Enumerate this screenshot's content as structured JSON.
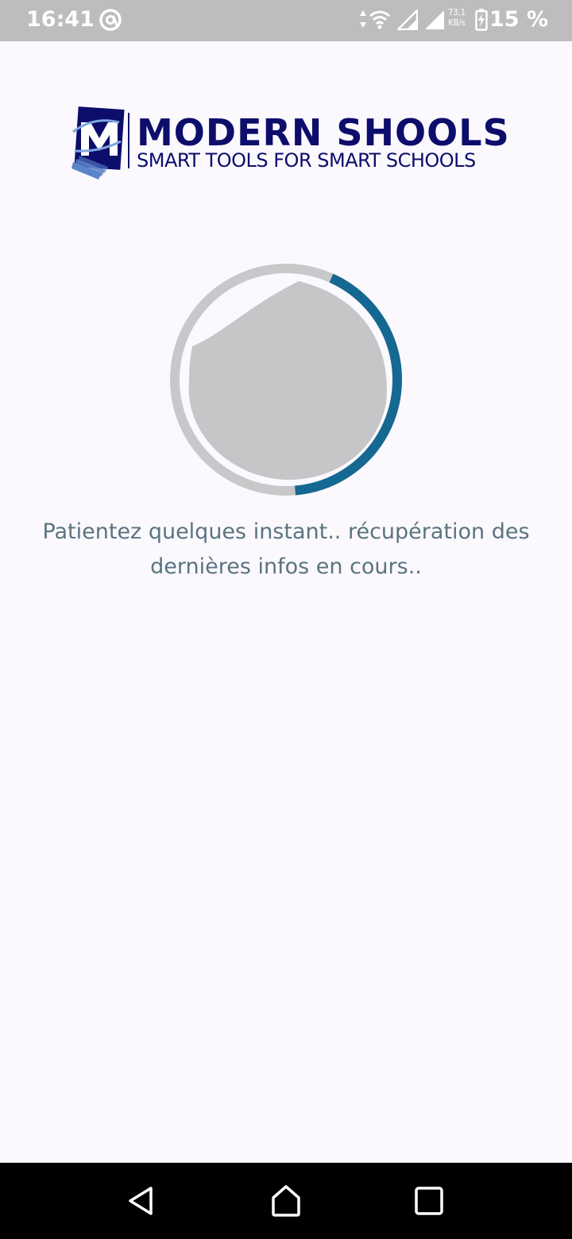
{
  "status_bar": {
    "time": "16:41",
    "net_speed_value": "73,1",
    "net_speed_unit": "KB/s",
    "battery_percent": "15 %",
    "icons": [
      "at-sign-icon",
      "data-arrows-icon",
      "wifi-icon",
      "signal-icon",
      "signal-icon",
      "battery-charging-icon"
    ]
  },
  "logo": {
    "title": "MODERN SHOOLS",
    "subtitle": "SMART TOOLS FOR SMART SCHOOLS",
    "brand_color": "#0d0d6b"
  },
  "loader": {
    "progress": 0.42,
    "track_color": "#c8c8ca",
    "progress_color": "#156891"
  },
  "message": {
    "text": "Patientez quelques instant.. récupération des dernières infos en cours.."
  },
  "nav_bar": {
    "buttons": [
      "back-icon",
      "home-icon",
      "recents-icon"
    ]
  }
}
